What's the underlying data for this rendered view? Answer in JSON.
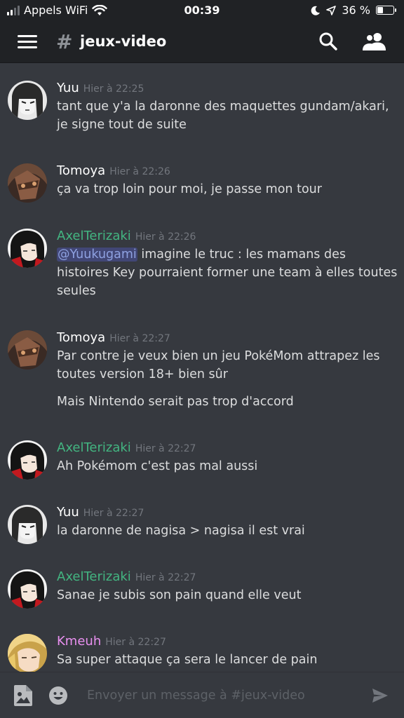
{
  "status_bar": {
    "carrier": "Appels WiFi",
    "time": "00:39",
    "battery_label": "36 %",
    "battery_level": 0.36
  },
  "header": {
    "channel_name": "jeux-video",
    "hash_symbol": "#",
    "icons": [
      "menu-icon",
      "search-icon",
      "members-icon"
    ]
  },
  "colors": {
    "yuu": "#ffffff",
    "tomoya": "#ffffff",
    "axel": "#43b581",
    "kmeuh": "#e990f0",
    "mention_bg": "#414675"
  },
  "messages": [
    {
      "author": "Yuu",
      "timestamp": "Hier à 22:25",
      "lines": [
        "tant que y'a la daronne des maquettes gundam/akari,",
        "je signe tout de suite"
      ]
    },
    {
      "author": "Tomoya",
      "timestamp": "Hier à 22:26",
      "lines": [
        "ça va trop loin pour moi, je passe mon tour"
      ]
    },
    {
      "author": "AxelTerizaki",
      "timestamp": "Hier à 22:26",
      "mention": "@Yuukugami",
      "lines": [
        " imagine le truc : les mamans des",
        "histoires Key pourraient former une team à elles toutes",
        "seules"
      ]
    },
    {
      "author": "Tomoya",
      "timestamp": "Hier à 22:27",
      "lines": [
        "Par contre je veux bien un jeu PokéMom attrapez les",
        "toutes version 18+ bien sûr",
        "Mais Nintendo serait pas trop d'accord"
      ]
    },
    {
      "author": "AxelTerizaki",
      "timestamp": "Hier à 22:27",
      "lines": [
        "Ah Pokémom c'est pas mal aussi"
      ]
    },
    {
      "author": "Yuu",
      "timestamp": "Hier à 22:27",
      "lines": [
        "la daronne de nagisa > nagisa il est vrai"
      ]
    },
    {
      "author": "AxelTerizaki",
      "timestamp": "Hier à 22:27",
      "lines": [
        "Sanae je subis son pain quand elle veut"
      ]
    },
    {
      "author": "Kmeuh",
      "timestamp": "Hier à 22:27",
      "lines": [
        "Sa super attaque ça sera le lancer de pain"
      ]
    }
  ],
  "composer": {
    "placeholder": "Envoyer un message à #jeux-video",
    "value": ""
  }
}
